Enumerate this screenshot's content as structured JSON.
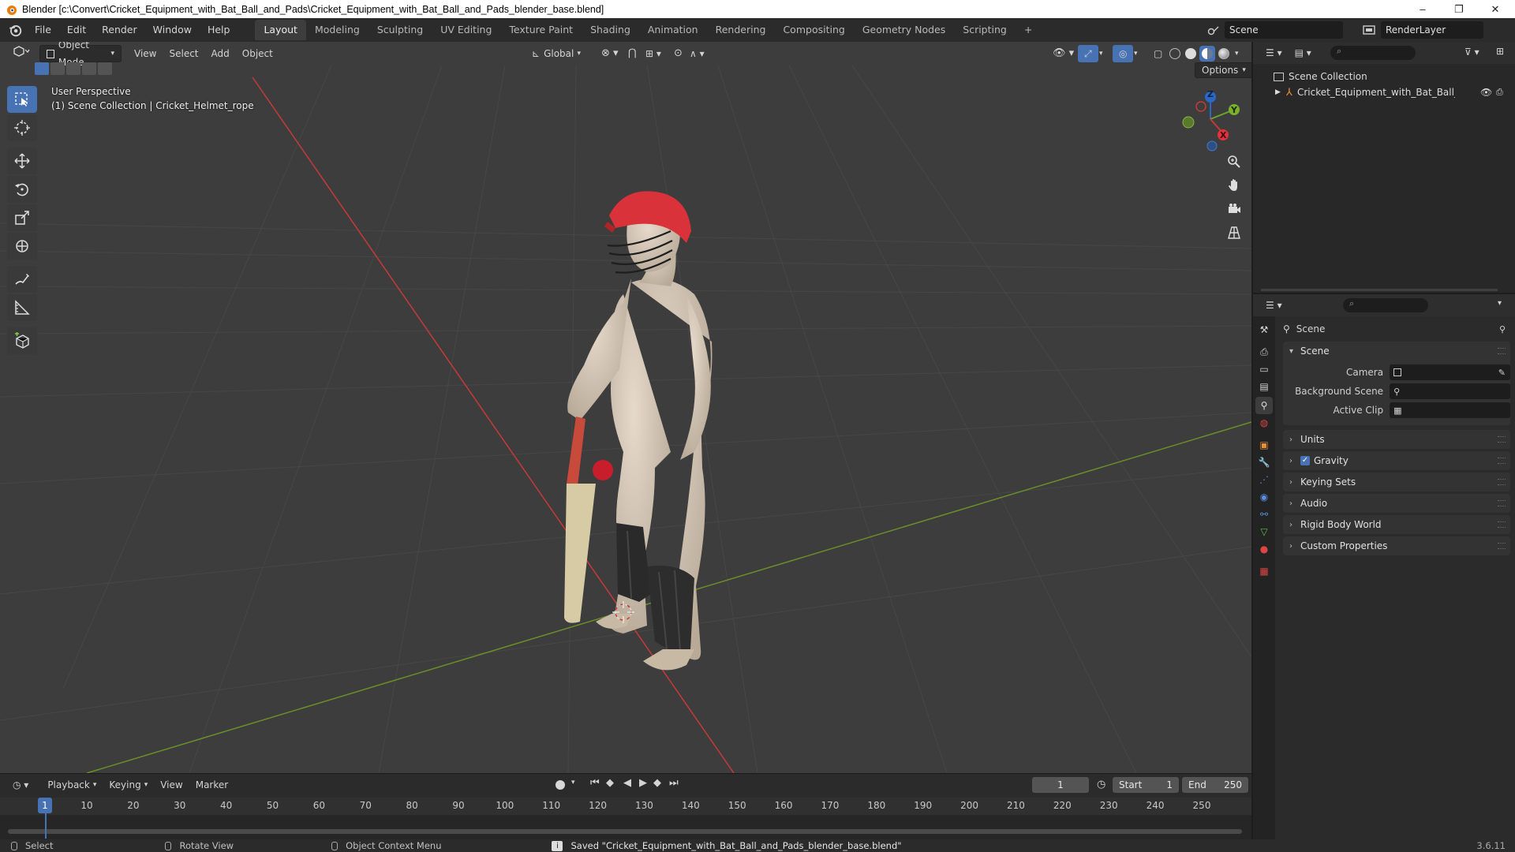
{
  "window": {
    "title": "Blender [c:\\Convert\\Cricket_Equipment_with_Bat_Ball_and_Pads\\Cricket_Equipment_with_Bat_Ball_and_Pads_blender_base.blend]",
    "minimize": "–",
    "maximize": "❐",
    "close": "✕"
  },
  "menu": [
    "File",
    "Edit",
    "Render",
    "Window",
    "Help"
  ],
  "workspaces": [
    "Layout",
    "Modeling",
    "Sculpting",
    "UV Editing",
    "Texture Paint",
    "Shading",
    "Animation",
    "Rendering",
    "Compositing",
    "Geometry Nodes",
    "Scripting"
  ],
  "workspace_add": "+",
  "scene": {
    "name": "Scene",
    "render_layer": "RenderLayer"
  },
  "viewport": {
    "mode": "Object Mode",
    "menus": [
      "View",
      "Select",
      "Add",
      "Object"
    ],
    "orientation": "Global",
    "options": "Options",
    "info_line1": "User Perspective",
    "info_line2": "(1) Scene Collection | Cricket_Helmet_rope",
    "gizmo_axes": {
      "z": "Z",
      "y": "Y",
      "x": "X"
    },
    "colors": {
      "background": "#3d3d3d",
      "x_axis": "#c63a3a",
      "y_axis": "#6a8f28",
      "grid": "#4a4a4a"
    }
  },
  "tools": [
    "select-box",
    "cursor",
    "move",
    "rotate",
    "scale",
    "transform",
    "annotate",
    "measure",
    "add-cube"
  ],
  "timeline": {
    "menus": [
      "Playback",
      "Keying",
      "View",
      "Marker"
    ],
    "current_frame": "1",
    "start_label": "Start",
    "start": "1",
    "end_label": "End",
    "end": "250",
    "ticks": [
      "1",
      "10",
      "20",
      "30",
      "40",
      "50",
      "60",
      "70",
      "80",
      "90",
      "100",
      "110",
      "120",
      "130",
      "140",
      "150",
      "160",
      "170",
      "180",
      "190",
      "200",
      "210",
      "220",
      "230",
      "240",
      "250"
    ]
  },
  "status": {
    "select": "Select",
    "rotate": "Rotate View",
    "context": "Object Context Menu",
    "message": "Saved \"Cricket_Equipment_with_Bat_Ball_and_Pads_blender_base.blend\"",
    "version": "3.6.11"
  },
  "outliner": {
    "root": "Scene Collection",
    "items": [
      {
        "label": "Cricket_Equipment_with_Bat_Ball_and_I"
      }
    ]
  },
  "properties": {
    "context": "Scene",
    "panel_title": "Scene",
    "camera_label": "Camera",
    "background_label": "Background Scene",
    "clip_label": "Active Clip",
    "panels": [
      "Units",
      "Gravity",
      "Keying Sets",
      "Audio",
      "Rigid Body World",
      "Custom Properties"
    ],
    "gravity_checked": true
  }
}
